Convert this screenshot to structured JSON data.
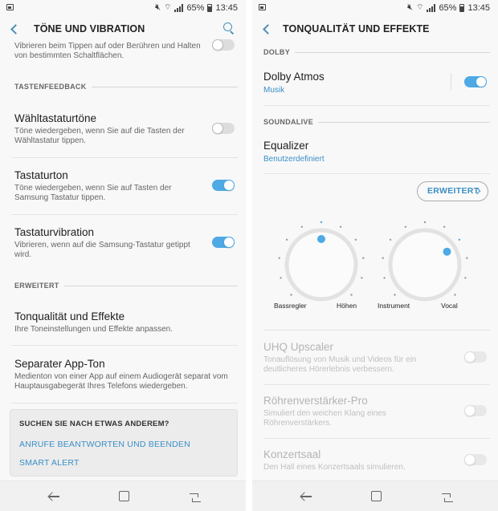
{
  "status": {
    "battery": "65%",
    "time": "13:45"
  },
  "left": {
    "title": "TÖNE UND VIBRATION",
    "top_partial": {
      "subtitle": "Vibrieren beim Tippen auf oder Berühren und Halten von bestimmten Schaltflächen.",
      "toggle": false
    },
    "section_tastenfeedback": "TASTENFEEDBACK",
    "waehltastatur": {
      "title": "Wähltastaturtöne",
      "subtitle": "Töne wiedergeben, wenn Sie auf die Tasten der Wähltastatur tippen.",
      "toggle": false
    },
    "tastaturton": {
      "title": "Tastaturton",
      "subtitle": "Töne wiedergeben, wenn Sie auf Tasten der Samsung Tastatur tippen.",
      "toggle": true
    },
    "tastaturvibration": {
      "title": "Tastaturvibration",
      "subtitle": "Vibrieren, wenn auf die Samsung-Tastatur getippt wird.",
      "toggle": true
    },
    "section_erweitert": "ERWEITERT",
    "tonqualitaet": {
      "title": "Tonqualität und Effekte",
      "subtitle": "Ihre Toneinstellungen und Effekte anpassen."
    },
    "separater": {
      "title": "Separater App-Ton",
      "subtitle": "Medienton von einer App auf einem Audiogerät separat vom Hauptausgabegerät Ihres Telefons wiedergeben."
    },
    "suggest": {
      "heading": "SUCHEN SIE NACH ETWAS ANDEREM?",
      "link1": "ANRUFE BEANTWORTEN UND BEENDEN",
      "link2": "SMART ALERT"
    }
  },
  "right": {
    "title": "TONQUALITÄT UND EFFEKTE",
    "section_dolby": "DOLBY",
    "dolby": {
      "title": "Dolby Atmos",
      "sub": "Musik",
      "toggle": true
    },
    "section_soundalive": "SOUNDALIVE",
    "equalizer": {
      "title": "Equalizer",
      "sub": "Benutzerdefiniert"
    },
    "weiter_button": "ERWEITERT",
    "dial_bass": {
      "left_label": "Bassregler",
      "right_label": "Höhen",
      "level": 0.5
    },
    "dial_vocal": {
      "left_label": "Instrument",
      "right_label": "Vocal",
      "level": 0.72
    },
    "uhq": {
      "title": "UHQ Upscaler",
      "subtitle": "Tonauflösung von Musik und Videos für ein deutlicheres Hörerlebnis verbessern.",
      "toggle": false
    },
    "roehren": {
      "title": "Röhrenverstärker-Pro",
      "subtitle": "Simuliert den weichen Klang eines Röhrenverstärkers.",
      "toggle": false
    },
    "konzert": {
      "title": "Konzertsaal",
      "subtitle": "Den Hall eines Konzertsaals simulieren.",
      "toggle": false
    }
  },
  "colors": {
    "accent": "#4ea9e5",
    "link": "#3a8fc7"
  }
}
